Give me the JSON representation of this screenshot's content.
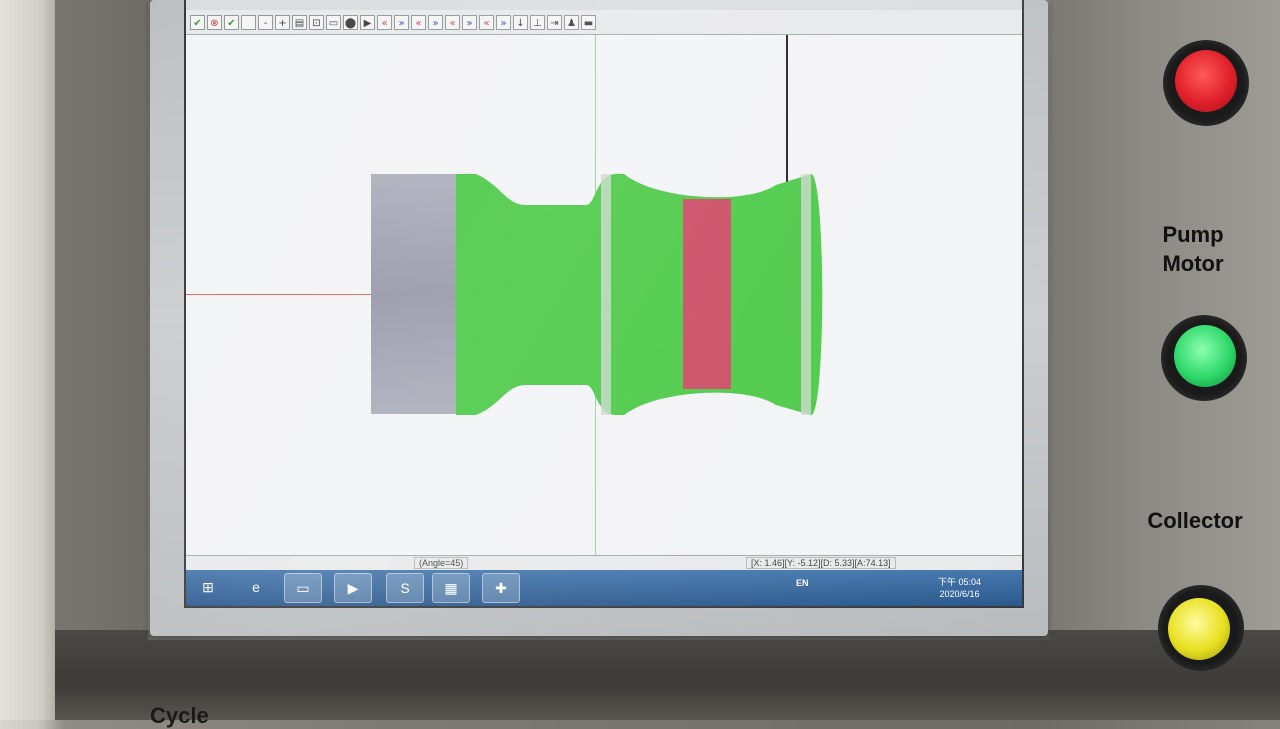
{
  "toolbar": {
    "icons": [
      "✔",
      "⊗",
      "✔",
      "",
      "-",
      "+",
      "▤",
      "⊡",
      "▭",
      "⬤",
      "▶",
      "«",
      "»",
      "«",
      "»",
      "«",
      "»",
      "«",
      "»",
      "↓",
      "⊥",
      "⇥",
      "♟",
      "▬"
    ]
  },
  "status": {
    "angle": "(Angle=45)",
    "coords": "[X: 1.46][Y: -5.12][D: 5.33][A:74.13]"
  },
  "taskbar": {
    "lang": "EN",
    "time": "下午 05:04",
    "date": "2020/6/16"
  },
  "panel": {
    "pump_motor_line1": "Pump",
    "pump_motor_line2": "Motor",
    "collector": "Collector",
    "cycle": "Cycle"
  },
  "colors": {
    "part_green": "#3fc63a",
    "part_red": "#c8405a",
    "stock_gray": "#9496a6",
    "lamp_red": "#e0202a",
    "lamp_green": "#2ed86a",
    "lamp_yellow": "#e8e020"
  }
}
